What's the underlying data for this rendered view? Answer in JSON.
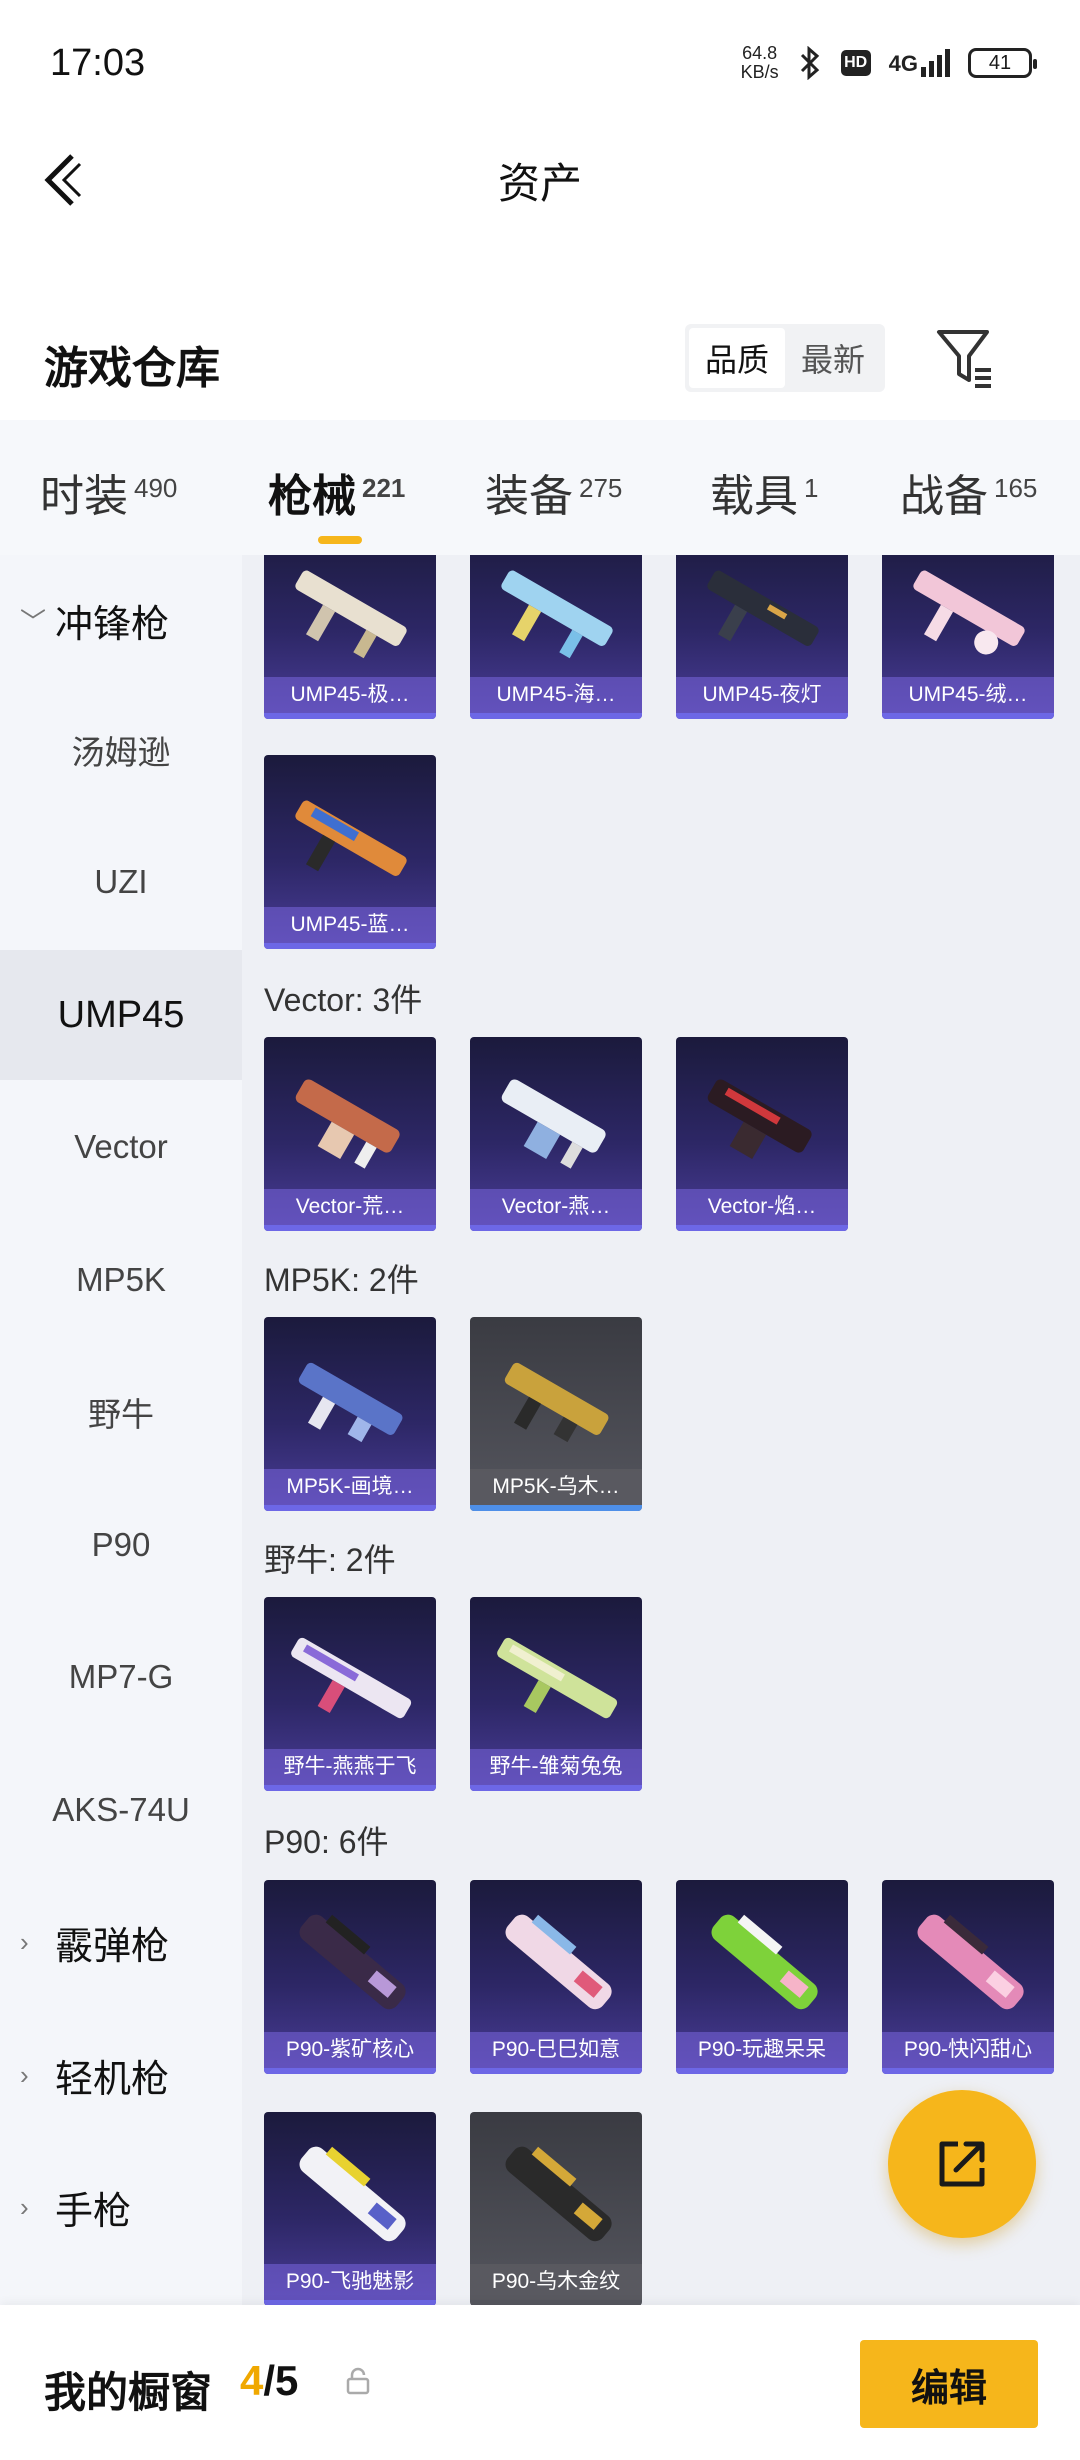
{
  "status": {
    "time": "17:03",
    "speed_top": "64.8",
    "speed_bottom": "KB/s",
    "hd": "HD",
    "signal": "4G",
    "battery": "41"
  },
  "header": {
    "title": "资产"
  },
  "section": {
    "title": "游戏仓库",
    "sort_quality": "品质",
    "sort_newest": "最新"
  },
  "tabs": [
    {
      "label": "时装",
      "count": "490"
    },
    {
      "label": "枪械",
      "count": "221"
    },
    {
      "label": "装备",
      "count": "275"
    },
    {
      "label": "载具",
      "count": "1"
    },
    {
      "label": "战备",
      "count": "165"
    }
  ],
  "sidebar": [
    {
      "label": "冲锋枪"
    },
    {
      "label": "汤姆逊"
    },
    {
      "label": "UZI"
    },
    {
      "label": "UMP45"
    },
    {
      "label": "Vector"
    },
    {
      "label": "MP5K"
    },
    {
      "label": "野牛"
    },
    {
      "label": "P90"
    },
    {
      "label": "MP7-G"
    },
    {
      "label": "AKS-74U"
    },
    {
      "label": "霰弹枪"
    },
    {
      "label": "轻机枪"
    },
    {
      "label": "手枪"
    }
  ],
  "groups": [
    {
      "title": "",
      "items": [
        "UMP45-极…",
        "UMP45-海…",
        "UMP45-夜灯",
        "UMP45-绒…",
        "UMP45-蓝…"
      ]
    },
    {
      "title": "Vector: 3件",
      "items": [
        "Vector-荒…",
        "Vector-燕…",
        "Vector-焰…"
      ]
    },
    {
      "title": "MP5K: 2件",
      "items": [
        "MP5K-画境…",
        "MP5K-乌木…"
      ]
    },
    {
      "title": "野牛: 2件",
      "items": [
        "野牛-燕燕于飞",
        "野牛-雏菊兔兔"
      ]
    },
    {
      "title": "P90: 6件",
      "items": [
        "P90-紫矿核心",
        "P90-巳巳如意",
        "P90-玩趣呆呆",
        "P90-快闪甜心",
        "P90-飞驰魅影",
        "P90-乌木金纹"
      ]
    }
  ],
  "bottom": {
    "label": "我的橱窗",
    "count_current": "4",
    "count_total": "/5",
    "edit": "编辑"
  }
}
